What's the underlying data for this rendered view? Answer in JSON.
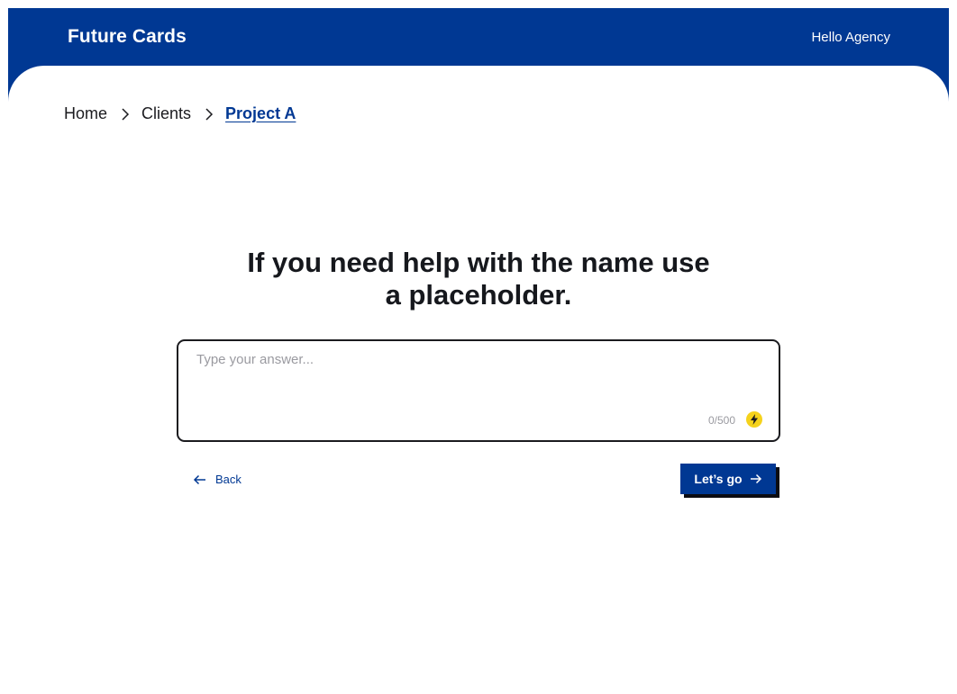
{
  "header": {
    "brand": "Future Cards",
    "greeting": "Hello Agency"
  },
  "breadcrumb": {
    "items": [
      {
        "label": "Home",
        "icon_after": "chevron-right-icon"
      },
      {
        "label": "Clients",
        "icon_after": "chevron-right-icon"
      },
      {
        "label": "Project A"
      }
    ]
  },
  "prompt": {
    "question": "If you need help with the name use a placeholder."
  },
  "answer": {
    "value": "",
    "placeholder": "Type your answer...",
    "counter": "0/500",
    "assist_icon": "lightning-bolt-icon"
  },
  "actions": {
    "back_label": "Back",
    "back_icon": "arrow-left-icon",
    "go_label": "Let’s go",
    "go_icon": "arrow-right-icon"
  },
  "colors": {
    "brand_blue": "#003893",
    "accent_yellow": "#f5d21c",
    "text_dark": "#16181d",
    "muted": "#9a9aa0"
  }
}
